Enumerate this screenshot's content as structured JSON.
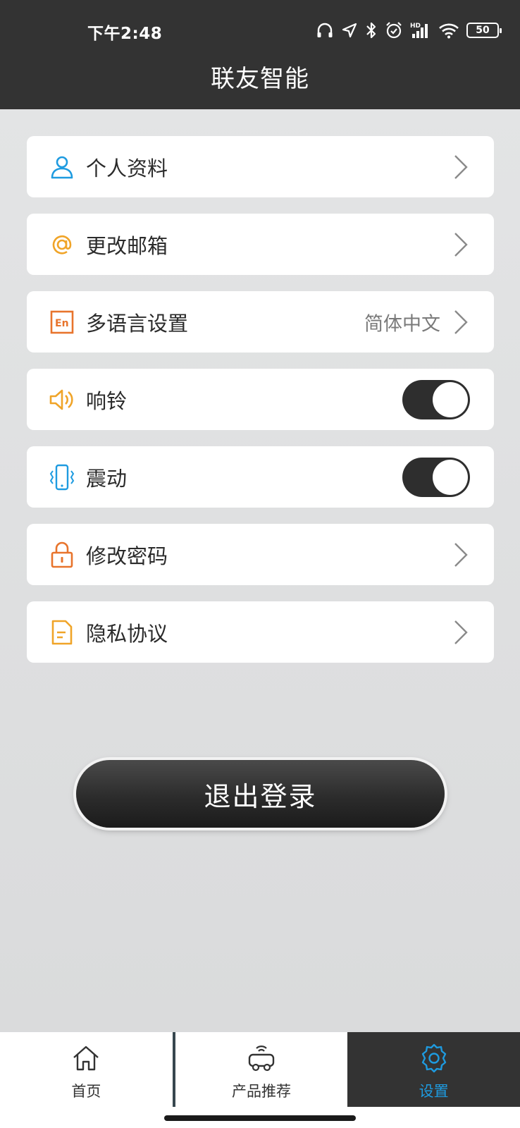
{
  "status_bar": {
    "time": "下午2:48",
    "battery": "50"
  },
  "header": {
    "title": "联友智能"
  },
  "settings": [
    {
      "label": "个人资料",
      "icon": "person-icon",
      "color": "#1e9be0",
      "type": "link"
    },
    {
      "label": "更改邮箱",
      "icon": "at-icon",
      "color": "#f0a428",
      "type": "link"
    },
    {
      "label": "多语言设置",
      "icon": "language-icon",
      "color": "#e8742c",
      "type": "link",
      "value": "简体中文"
    },
    {
      "label": "响铃",
      "icon": "speaker-icon",
      "color": "#f0a428",
      "type": "toggle",
      "on": true
    },
    {
      "label": "震动",
      "icon": "vibrate-icon",
      "color": "#1e9be0",
      "type": "toggle",
      "on": true
    },
    {
      "label": "修改密码",
      "icon": "lock-icon",
      "color": "#e8742c",
      "type": "link"
    },
    {
      "label": "隐私协议",
      "icon": "document-icon",
      "color": "#f0a428",
      "type": "link"
    }
  ],
  "logout": {
    "label": "退出登录"
  },
  "tabs": [
    {
      "label": "首页",
      "icon": "home-icon",
      "active": false
    },
    {
      "label": "产品推荐",
      "icon": "robot-car-icon",
      "active": false
    },
    {
      "label": "设置",
      "icon": "gear-icon",
      "active": true
    }
  ],
  "colors": {
    "header_bg": "#333333",
    "accent_blue": "#1e9be0",
    "accent_orange": "#e8742c",
    "accent_yellow": "#f0a428"
  }
}
